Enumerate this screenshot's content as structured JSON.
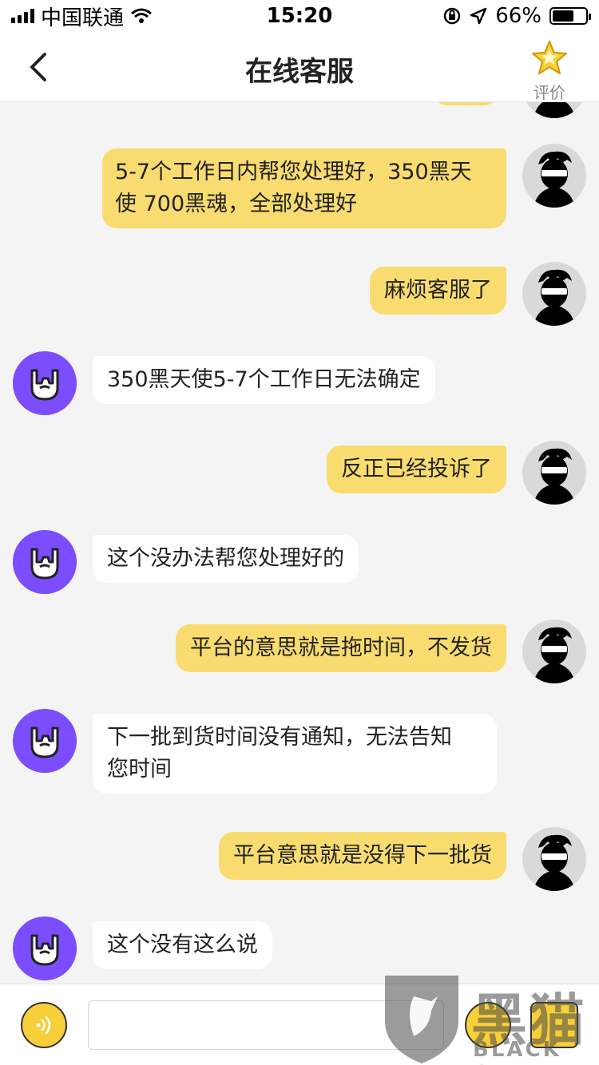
{
  "status_bar": {
    "carrier": "中国联通",
    "time": "15:20",
    "battery": "66%",
    "battery_level": 0.66
  },
  "nav": {
    "title": "在线客服",
    "rate_label": "评价"
  },
  "messages": [
    {
      "role": "user",
      "text_lines": [
        "5-7个工作日内帮您处理好，350黑天",
        "使 700黑魂，全部处理好"
      ]
    },
    {
      "role": "user",
      "text_lines": [
        "麻烦客服了"
      ]
    },
    {
      "role": "bot",
      "text_lines": [
        "350黑天使5-7个工作日无法确定"
      ]
    },
    {
      "role": "user",
      "text_lines": [
        "反正已经投诉了"
      ]
    },
    {
      "role": "bot",
      "text_lines": [
        "这个没办法帮您处理好的"
      ]
    },
    {
      "role": "user",
      "text_lines": [
        "平台的意思就是拖时间，不发货"
      ]
    },
    {
      "role": "bot",
      "text_lines": [
        "下一批到货时间没有通知，无法告知",
        "您时间"
      ]
    },
    {
      "role": "user",
      "text_lines": [
        "平台意思就是没得下一批货"
      ]
    },
    {
      "role": "bot",
      "text_lines": [
        "这个没有这么说"
      ]
    }
  ],
  "input": {
    "value": "",
    "placeholder": ""
  },
  "watermark": {
    "cn": "黑猫",
    "en": "BLACK CAT"
  },
  "colors": {
    "user_bubble": "#f9dc6f",
    "bot_bubble": "#ffffff",
    "bot_avatar": "#7c4dff",
    "accent": "#f7cf3a"
  }
}
